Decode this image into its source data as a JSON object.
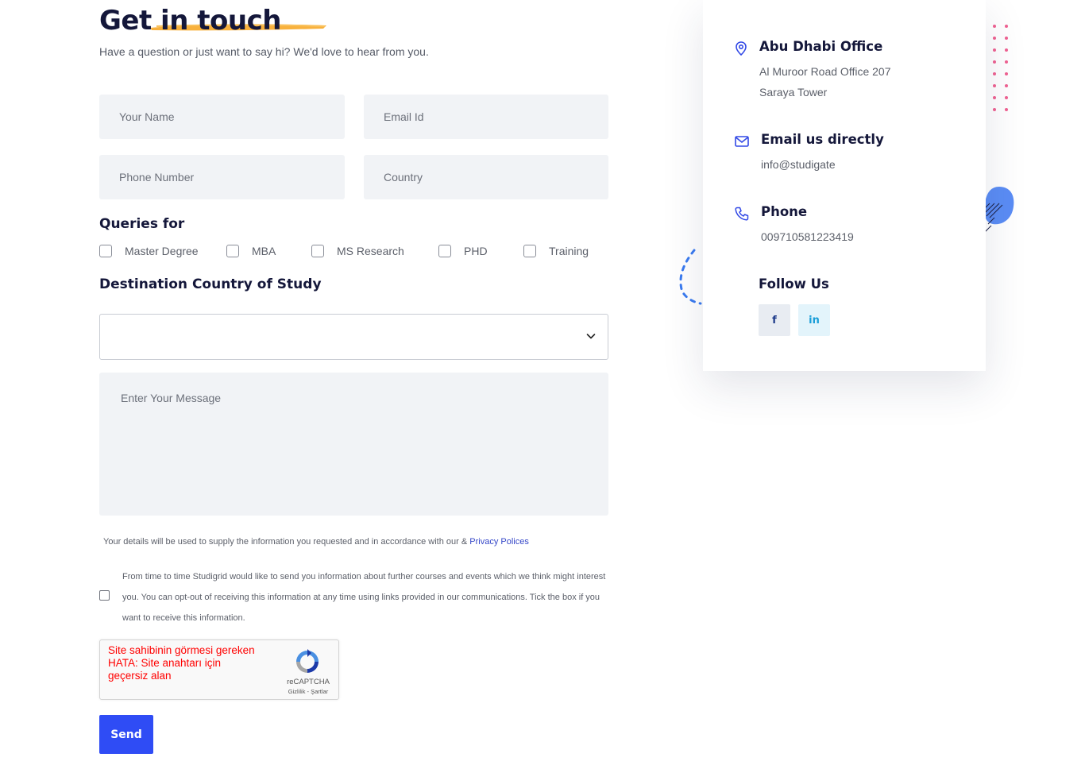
{
  "header": {
    "title": "Get in touch",
    "subtitle": "Have a question or just want to say hi? We'd love to hear from you."
  },
  "form": {
    "name_placeholder": "Your Name",
    "email_placeholder": "Email Id",
    "phone_placeholder": "Phone Number",
    "country_placeholder": "Country",
    "queries_label": "Queries for",
    "queries": [
      {
        "label": "Master Degree",
        "checked": false
      },
      {
        "label": "MBA",
        "checked": false
      },
      {
        "label": "MS Research",
        "checked": false
      },
      {
        "label": "PHD",
        "checked": false
      },
      {
        "label": "Training",
        "checked": false
      }
    ],
    "destination_label": "Destination Country of Study",
    "destination_value": "",
    "message_placeholder": "Enter Your Message",
    "privacy_text": "Your details will be used to supply the information you requested and in accordance with our & ",
    "privacy_link": "Privacy Polices",
    "optin_text": "From time to time Studigrid would like to send you information about further courses and events which we think might interest you. You can opt-out of receiving this information at any time using links provided in our communications. Tick the box if you want to receive this information.",
    "optin_checked": false,
    "send_label": "Send"
  },
  "captcha": {
    "error_text": "Site sahibinin görmesi gereken HATA: Site anahtarı için geçersiz alan",
    "brand": "reCAPTCHA",
    "links": "Gizlilik - Şartlar"
  },
  "contact": {
    "office_title": "Abu Dhabi Office",
    "office_line1": "Al Muroor Road Office 207",
    "office_line2": "Saraya Tower",
    "email_title": "Email us directly",
    "email_value": "info@studigate",
    "phone_title": "Phone",
    "phone_value": "009710581223419",
    "follow_title": "Follow Us",
    "facebook_glyph": "f",
    "linkedin_glyph": "in"
  },
  "colors": {
    "primary": "#2f4cf5",
    "heading": "#14173a",
    "field_bg": "#f1f3f6",
    "accent_brush": "#f7a928",
    "error_red": "#ff0000",
    "dots_pink": "#f06292"
  },
  "icons": {
    "office": "map-pin-icon",
    "email": "envelope-icon",
    "phone": "phone-icon",
    "facebook": "facebook-icon",
    "linkedin": "linkedin-icon",
    "select": "chevron-down-icon"
  }
}
